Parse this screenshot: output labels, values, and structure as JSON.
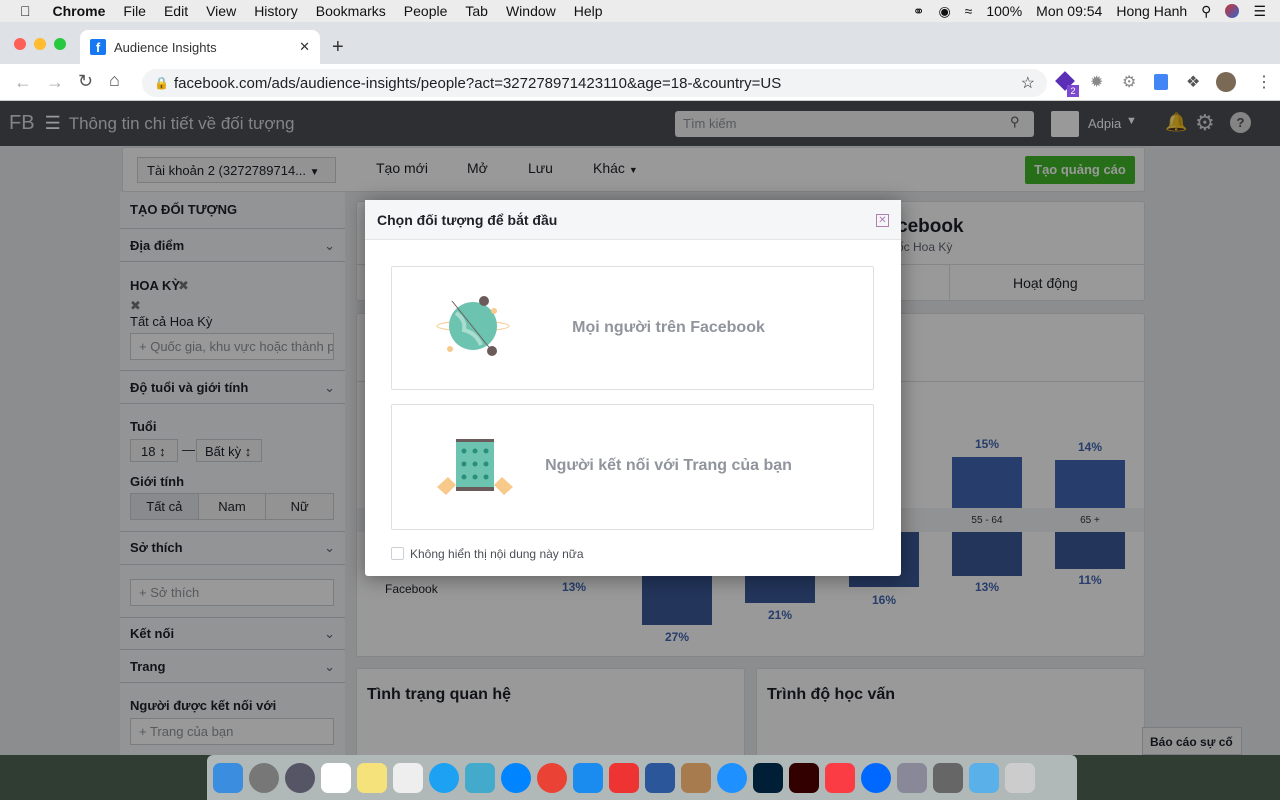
{
  "menubar": {
    "app": "Chrome",
    "items": [
      "File",
      "Edit",
      "View",
      "History",
      "Bookmarks",
      "People",
      "Tab",
      "Window",
      "Help"
    ],
    "battery": "100%",
    "clock": "Mon 09:54",
    "user": "Hong Hanh"
  },
  "browser": {
    "tab_title": "Audience Insights",
    "url": "facebook.com/ads/audience-insights/people?act=327278971423110&age=18-&country=US",
    "ext_badge": "2"
  },
  "fb": {
    "logo": "FB",
    "title": "Thông tin chi tiết về đối tượng",
    "search_placeholder": "Tìm kiếm",
    "account_name": "Adpia"
  },
  "toolbar": {
    "account": "Tài khoản 2 (3272789714...",
    "new": "Tạo mới",
    "open": "Mở",
    "save": "Lưu",
    "more": "Khác",
    "create_ad": "Tạo quảng cáo"
  },
  "sidebar": {
    "title": "TẠO ĐỐI TƯỢNG",
    "location": "Địa điểm",
    "country": "HOA KỲ",
    "all_country": "Tất cả Hoa Kỳ",
    "location_placeholder": "Quốc gia, khu vực hoặc thành phố",
    "age_gender": "Độ tuổi và giới tính",
    "age_label": "Tuổi",
    "age_min": "18",
    "age_max": "Bất kỳ",
    "gender_label": "Giới tính",
    "gender_options": [
      "Tất cả",
      "Nam",
      "Nữ"
    ],
    "interests": "Sở thích",
    "interests_placeholder": "Sở thích",
    "connections": "Kết nối",
    "pages": "Trang",
    "connected_to": "Người được kết nối với",
    "pages_placeholder": "Trang của bạn"
  },
  "main": {
    "title_fragment": "cebook",
    "subtitle_fragment": "ốc Hoa Kỳ",
    "tab_activity": "Hoạt động",
    "left_label": "Facebook",
    "left_pct": "13%",
    "age_groups": [
      "55 - 64",
      "65 +"
    ],
    "top_pcts": [
      "15%",
      "14%"
    ],
    "bottom_pcts": [
      "27%",
      "21%",
      "16%",
      "13%",
      "11%"
    ],
    "relationship": "Tình trạng quan hệ",
    "education": "Trình độ học vấn",
    "report": "Báo cáo sự cố"
  },
  "modal": {
    "title": "Chọn đối tượng để bắt đầu",
    "option1": "Mọi người trên Facebook",
    "option2": "Người kết nối với Trang của bạn",
    "dont_show": "Không hiển thị nội dung này nữa"
  },
  "colors": {
    "fb_blue": "#4267b2",
    "create_green": "#42b72a",
    "header": "#4b4f56"
  }
}
